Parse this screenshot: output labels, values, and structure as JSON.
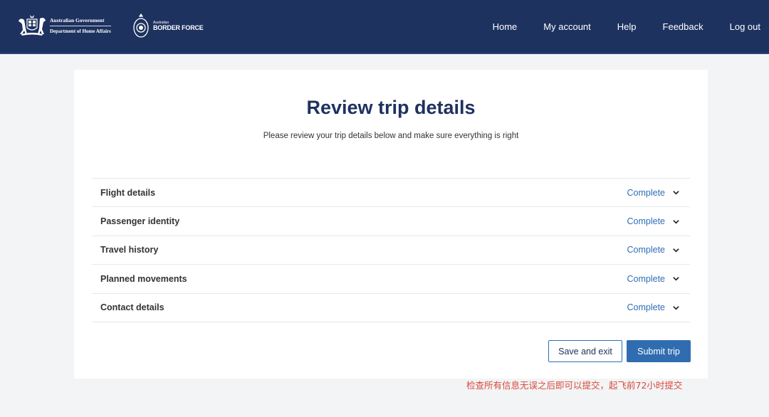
{
  "header": {
    "gov_line1": "Australian Government",
    "gov_line2": "Department of Home Affairs",
    "abf_small": "Australian",
    "abf_big": "BORDER FORCE",
    "nav": [
      "Home",
      "My account",
      "Help",
      "Feedback",
      "Log out"
    ]
  },
  "main": {
    "title": "Review trip details",
    "subtitle": "Please review your trip details below and make sure everything is right",
    "sections": [
      {
        "label": "Flight details",
        "status": "Complete"
      },
      {
        "label": "Passenger identity",
        "status": "Complete"
      },
      {
        "label": "Travel history",
        "status": "Complete"
      },
      {
        "label": "Planned movements",
        "status": "Complete"
      },
      {
        "label": "Contact details",
        "status": "Complete"
      }
    ],
    "save_label": "Save and exit",
    "submit_label": "Submit trip"
  },
  "annotation": "检查所有信息无误之后即可以提交，起飞前72小时提交",
  "colors": {
    "header_bg": "#1e3260",
    "title": "#1e3260",
    "accent": "#2f6db0",
    "status": "#2d6fb7",
    "annotation": "#d94a3a"
  }
}
